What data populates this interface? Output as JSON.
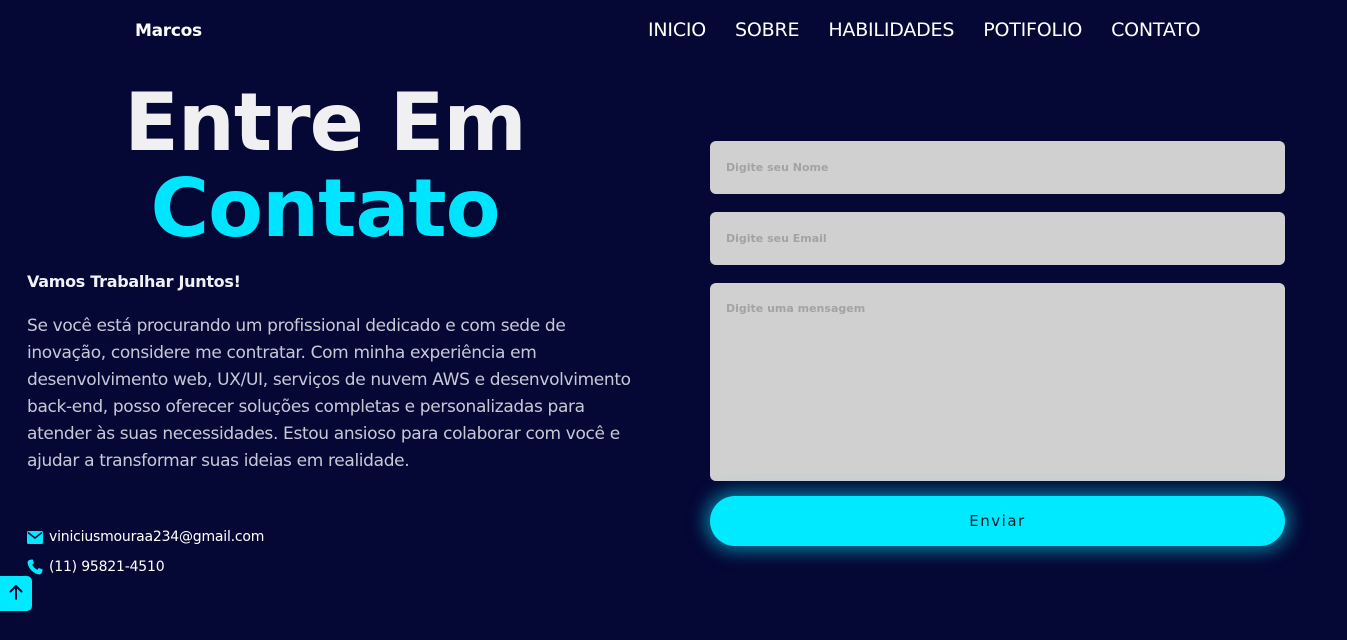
{
  "nav": {
    "brand": "Marcos",
    "links": [
      "INICIO",
      "SOBRE",
      "HABILIDADES",
      "POTIFOLIO",
      "CONTATO"
    ]
  },
  "hero": {
    "title_line1": "Entre Em",
    "title_line2": "Contato",
    "subtitle": "Vamos Trabalhar Juntos!",
    "description": "Se você está procurando um profissional dedicado e com sede de inovação, considere me contratar. Com minha experiência em desenvolvimento web, UX/UI, serviços de nuvem AWS e desenvolvimento back-end, posso oferecer soluções completas e personalizadas para atender às suas necessidades. Estou ansioso para colaborar com você e ajudar a transformar suas ideias em realidade.",
    "email": "viniciusmouraa234@gmail.com",
    "phone": "(11) 95821-4510"
  },
  "form": {
    "name_placeholder": "Digite seu Nome",
    "email_placeholder": "Digite seu Email",
    "message_placeholder": "Digite uma mensagem",
    "submit_label": "Enviar"
  },
  "icons": {
    "email": "envelope-icon",
    "phone": "phone-icon",
    "back_to_top": "arrow-up-icon"
  },
  "colors": {
    "background": "#050735",
    "accent": "#00eaff",
    "field_bg": "#d0d0d0"
  }
}
